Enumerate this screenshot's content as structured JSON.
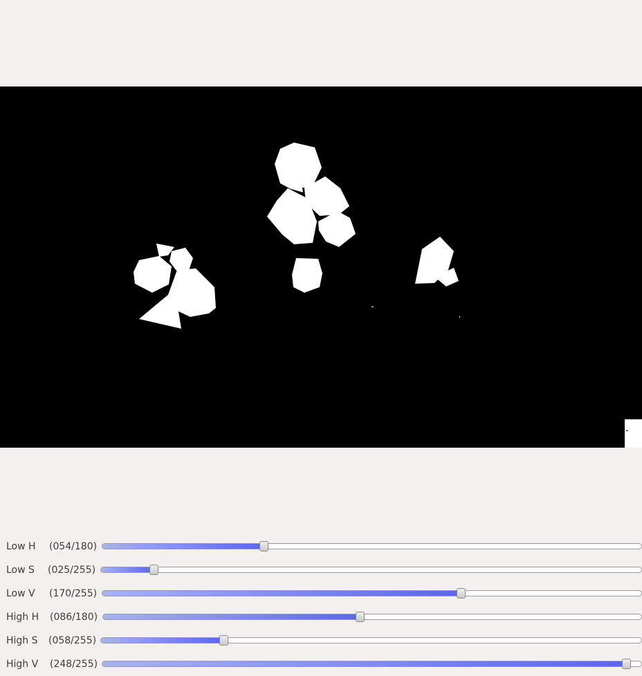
{
  "image_view": {
    "content": "binary-threshold-mask"
  },
  "trackbars": [
    {
      "name": "Low H",
      "value_text": "(054/180)",
      "value": 54,
      "max": 180
    },
    {
      "name": "Low S",
      "value_text": "(025/255)",
      "value": 25,
      "max": 255
    },
    {
      "name": "Low V",
      "value_text": "(170/255)",
      "value": 170,
      "max": 255
    },
    {
      "name": "High H",
      "value_text": "(086/180)",
      "value": 86,
      "max": 180
    },
    {
      "name": "High S",
      "value_text": "(058/255)",
      "value": 58,
      "max": 255
    },
    {
      "name": "High V",
      "value_text": "(248/255)",
      "value": 248,
      "max": 255
    }
  ]
}
